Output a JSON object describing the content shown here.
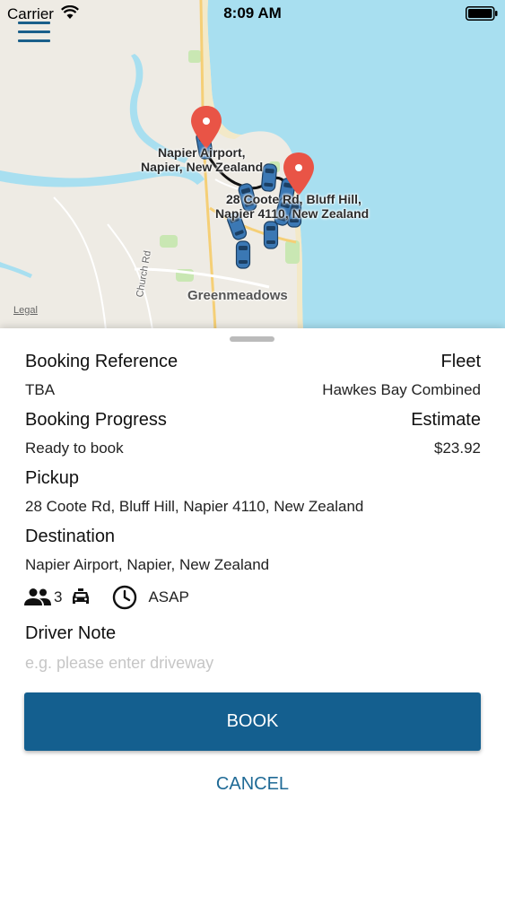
{
  "status_bar": {
    "carrier": "Carrier",
    "time": "8:09 AM"
  },
  "map": {
    "labels": {
      "airport_line1": "Napier Airport,",
      "airport_line2": "Napier, New Zealand",
      "pickup_line1": "28 Coote Rd, Bluff Hill,",
      "pickup_line2": "Napier 4110, New Zealand",
      "greenmeadows": "Greenmeadows",
      "church_rd": "Church Rd",
      "legal": "Legal"
    },
    "colors": {
      "water": "#a8dff0",
      "land": "#eeebe4",
      "route": "#111111",
      "pin": "#e95446",
      "taxi": "#3b78b4"
    },
    "icons": {
      "pin": "map-pin-icon",
      "taxi": "taxi-car-icon"
    }
  },
  "booking": {
    "reference_label": "Booking Reference",
    "reference_value": "TBA",
    "fleet_label": "Fleet",
    "fleet_value": "Hawkes Bay Combined",
    "progress_label": "Booking Progress",
    "progress_value": "Ready to book",
    "estimate_label": "Estimate",
    "estimate_value": "$23.92",
    "pickup_label": "Pickup",
    "pickup_value": "28 Coote Rd, Bluff Hill, Napier 4110, New Zealand",
    "destination_label": "Destination",
    "destination_value": "Napier Airport, Napier, New Zealand",
    "passengers": "3",
    "time": "ASAP",
    "driver_note_label": "Driver Note",
    "driver_note_placeholder": "e.g. please enter driveway",
    "driver_note_value": ""
  },
  "actions": {
    "book": "BOOK",
    "cancel": "CANCEL"
  },
  "theme": {
    "accent": "#145f8f",
    "link": "#1f6a96"
  }
}
